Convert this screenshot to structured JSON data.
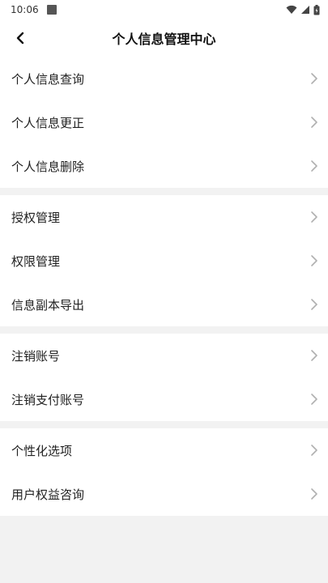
{
  "status_bar": {
    "time": "10:06"
  },
  "header": {
    "title": "个人信息管理中心"
  },
  "groups": [
    {
      "items": [
        {
          "label": "个人信息查询"
        },
        {
          "label": "个人信息更正"
        },
        {
          "label": "个人信息删除"
        }
      ]
    },
    {
      "items": [
        {
          "label": "授权管理"
        },
        {
          "label": "权限管理"
        },
        {
          "label": "信息副本导出"
        }
      ]
    },
    {
      "items": [
        {
          "label": "注销账号"
        },
        {
          "label": "注销支付账号"
        }
      ]
    },
    {
      "items": [
        {
          "label": "个性化选项"
        },
        {
          "label": "用户权益咨询"
        }
      ]
    }
  ],
  "colors": {
    "background": "#f2f2f2",
    "card": "#ffffff",
    "chevron": "#b0b0b0"
  }
}
